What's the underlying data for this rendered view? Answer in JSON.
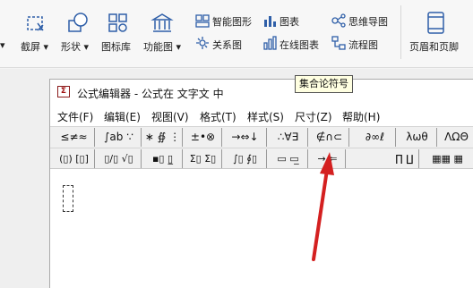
{
  "ribbon": {
    "items": [
      {
        "label": "截屏",
        "dropdown": true
      },
      {
        "label": "形状",
        "dropdown": true
      },
      {
        "label": "图标库",
        "dropdown": false
      },
      {
        "label": "功能图",
        "dropdown": true
      },
      {
        "label": "智能图形"
      },
      {
        "label": "关系图"
      },
      {
        "label": "图表"
      },
      {
        "label": "在线图表"
      },
      {
        "label": "思维导图"
      },
      {
        "label": "流程图"
      },
      {
        "label": "页眉和页脚"
      }
    ]
  },
  "editor": {
    "title": "公式编辑器 - 公式在 文字文 中",
    "menus": [
      "文件(F)",
      "编辑(E)",
      "视图(V)",
      "格式(T)",
      "样式(S)",
      "尺寸(Z)",
      "帮助(H)"
    ],
    "toolbar_row1": [
      {
        "label": "≤≠≈",
        "name": "relations-palette"
      },
      {
        "label": "∫ab ∵",
        "name": "spaces-ellipses-palette"
      },
      {
        "label": "∗ ∯ ⋮",
        "name": "embellishments-palette"
      },
      {
        "label": "±•⊗",
        "name": "operators-palette"
      },
      {
        "label": "→⇔↓",
        "name": "arrows-palette"
      },
      {
        "label": "∴∀∃",
        "name": "logic-palette"
      },
      {
        "label": "∉∩⊂",
        "name": "set-theory-palette"
      },
      {
        "label": "∂∞ℓ",
        "name": "misc-symbols-palette"
      },
      {
        "label": "λωθ",
        "name": "greek-lowercase-palette"
      },
      {
        "label": "ΛΩΘ",
        "name": "greek-uppercase-palette"
      }
    ],
    "toolbar_row2": [
      {
        "label": "(▯) [▯]",
        "name": "fences-palette"
      },
      {
        "label": "▯/▯ √▯",
        "name": "fraction-radical-palette"
      },
      {
        "label": "▪▯ ▯̲",
        "name": "sub-superscript-palette"
      },
      {
        "label": "Σ▯ Σ▯",
        "name": "summation-palette"
      },
      {
        "label": "∫▯ ∮▯",
        "name": "integral-palette"
      },
      {
        "label": "▭ ▭̲",
        "name": "underbar-overbar-palette"
      },
      {
        "label": "→ ⇐",
        "name": "labeled-arrow-palette"
      },
      {
        "label": "∏ ∐",
        "name": "products-palette"
      },
      {
        "label": "▦▦ ▦",
        "name": "matrix-palette"
      }
    ],
    "tooltip": "集合论符号"
  },
  "colors": {
    "accent": "#d42020",
    "tooltip_bg": "#ffffe1",
    "ribbon_icon": "#2f5fa8"
  }
}
